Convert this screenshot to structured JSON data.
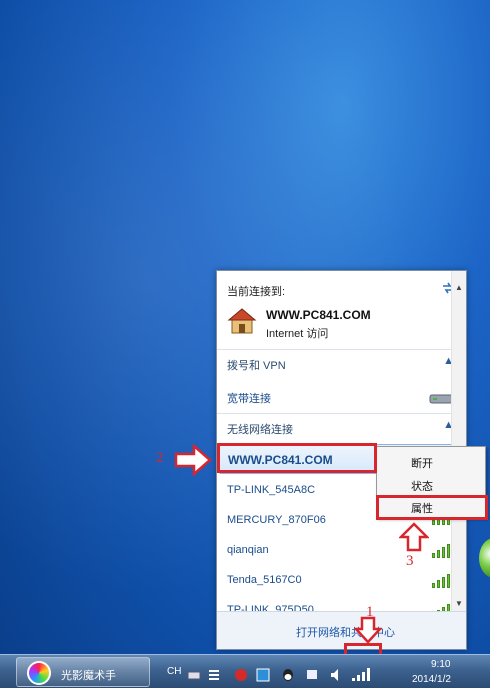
{
  "network_flyout": {
    "current_title": "当前连接到:",
    "current_connection": {
      "name": "WWW.PC841.COM",
      "status": "Internet 访问",
      "icon": "house-icon"
    },
    "dialup_section": {
      "label": "拨号和 VPN",
      "items": [
        {
          "label": "宽带连接",
          "icon": "modem-icon"
        }
      ]
    },
    "wireless_section": {
      "label": "无线网络连接",
      "networks": [
        {
          "name": "WWW.PC841.COM",
          "selected": true
        },
        {
          "name": "TP-LINK_545A8C",
          "selected": false
        },
        {
          "name": "MERCURY_870F06",
          "selected": false
        },
        {
          "name": "qianqian",
          "selected": false
        },
        {
          "name": "Tenda_5167C0",
          "selected": false
        },
        {
          "name": "TP-LINK_975D50",
          "selected": false
        }
      ]
    },
    "footer_link": "打开网络和共享中心"
  },
  "context_menu": {
    "items": [
      "断开",
      "状态",
      "属性"
    ],
    "highlighted": "属性"
  },
  "annotations": [
    "1",
    "2",
    "3"
  ],
  "taskbar": {
    "app_button_label": "光影魔术手",
    "language": "CH",
    "time": "9:10",
    "date": "2014/1/2"
  },
  "colors": {
    "desktop": "#1c64c6",
    "annotation_red": "#d8262e",
    "link_blue": "#1b4d8b",
    "signal_green": "#6bbf3a"
  }
}
